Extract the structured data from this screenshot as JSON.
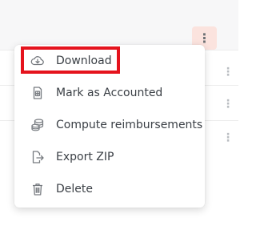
{
  "toolbar": {
    "more_actions_icon": "vertical-ellipsis-icon",
    "more_actions_label": "⋮"
  },
  "menu": {
    "items": [
      {
        "label": "Download",
        "icon": "cloud-download-icon"
      },
      {
        "label": "Mark as Accounted",
        "icon": "document-icon"
      },
      {
        "label": "Compute reimbursements",
        "icon": "coins-icon"
      },
      {
        "label": "Export ZIP",
        "icon": "file-export-icon"
      },
      {
        "label": "Delete",
        "icon": "trash-icon"
      }
    ]
  },
  "colors": {
    "highlight": "#e5131d",
    "kebab_bg": "#fbe3de",
    "text": "#3a3f45",
    "icon": "#777b80"
  }
}
